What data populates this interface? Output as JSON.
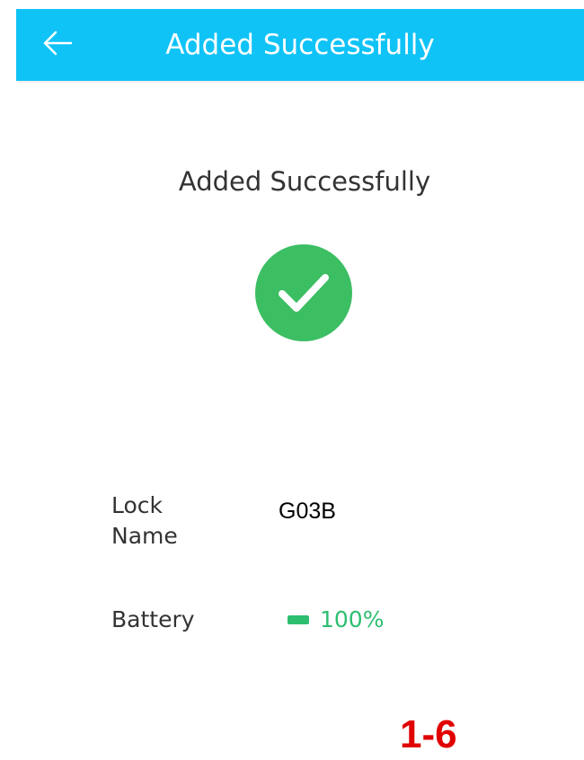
{
  "app_bar": {
    "title": "Added Successfully",
    "back_icon": "arrow-left-icon",
    "color": "#10C3F7"
  },
  "main": {
    "heading": "Added Successfully",
    "status_icon": "check-circle-icon",
    "status_color": "#3CBE63"
  },
  "details": {
    "lock_name_label": "Lock Name",
    "lock_name_value": "G03B",
    "battery_label": "Battery",
    "battery_icon": "battery-icon",
    "battery_value": "100%",
    "battery_color": "#2DBE70"
  },
  "footer": {
    "page_number": "1-6",
    "page_number_color": "#E00000"
  }
}
